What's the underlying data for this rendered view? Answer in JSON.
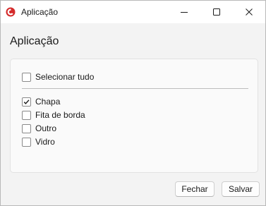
{
  "window": {
    "title": "Aplicação",
    "icon": "app-logo-icon",
    "accent_color": "#d42a2a",
    "controls": {
      "minimize_icon": "minimize-icon",
      "maximize_icon": "maximize-icon",
      "close_icon": "close-icon"
    }
  },
  "page": {
    "heading": "Aplicação"
  },
  "selection": {
    "select_all": {
      "label": "Selecionar tudo",
      "checked": false
    },
    "items": [
      {
        "label": "Chapa",
        "checked": true
      },
      {
        "label": "Fita de borda",
        "checked": false
      },
      {
        "label": "Outro",
        "checked": false
      },
      {
        "label": "Vidro",
        "checked": false
      }
    ]
  },
  "footer": {
    "close_label": "Fechar",
    "save_label": "Salvar"
  }
}
